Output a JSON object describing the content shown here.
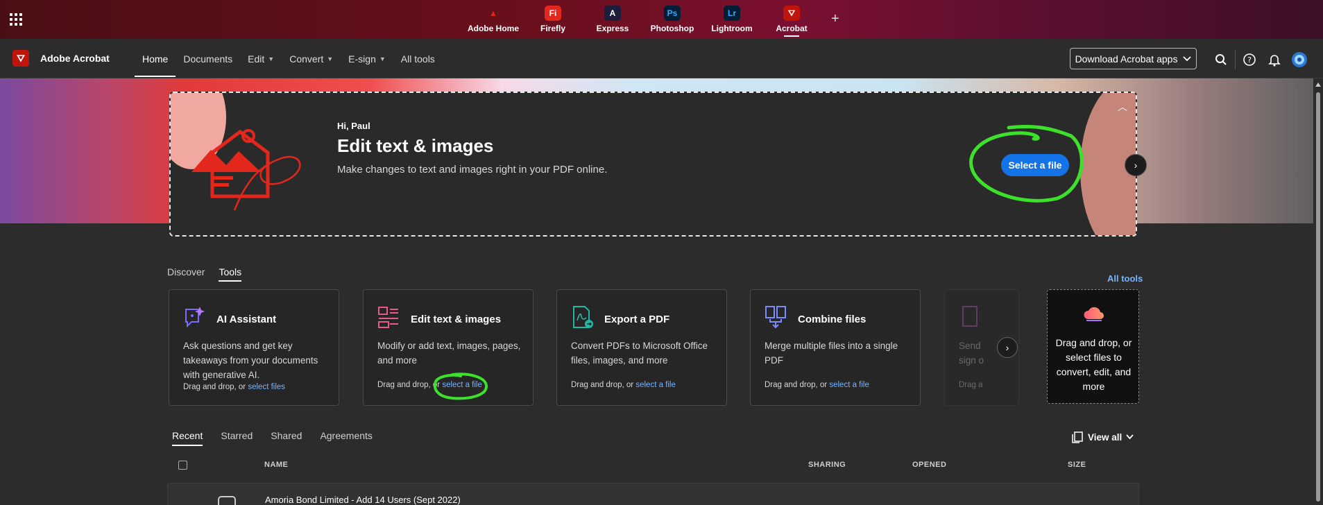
{
  "apps": [
    {
      "name": "Adobe Home",
      "icon": "adobe-home-icon",
      "glyph": "▲",
      "color": "transparent",
      "textColor": "#e3271d"
    },
    {
      "name": "Firefly",
      "icon": "firefly-icon",
      "glyph": "Fi",
      "color": "#e3271d",
      "textColor": "#fff"
    },
    {
      "name": "Express",
      "icon": "express-icon",
      "glyph": "A",
      "color": "#1b1d3a",
      "textColor": "#fff"
    },
    {
      "name": "Photoshop",
      "icon": "photoshop-icon",
      "glyph": "Ps",
      "color": "#001e36",
      "textColor": "#31a8ff"
    },
    {
      "name": "Lightroom",
      "icon": "lightroom-icon",
      "glyph": "Lr",
      "color": "#001e36",
      "textColor": "#31a8ff"
    },
    {
      "name": "Acrobat",
      "icon": "acrobat-icon",
      "glyph": "⛛",
      "color": "#c0150d",
      "textColor": "#fff"
    }
  ],
  "brand": {
    "title": "Adobe Acrobat"
  },
  "nav": {
    "items": [
      "Home",
      "Documents",
      "Edit",
      "Convert",
      "E-sign",
      "All tools"
    ],
    "download_label": "Download Acrobat apps"
  },
  "hero": {
    "greeting": "Hi, Paul",
    "headline": "Edit text & images",
    "subtitle": "Make changes to text and images right in your PDF online.",
    "button": "Select a file"
  },
  "tabs": [
    "Discover",
    "Tools"
  ],
  "all_tools_link": "All tools",
  "cards": [
    {
      "title": "AI Assistant",
      "desc": "Ask questions and get key takeaways from your documents with generative AI.",
      "drag_prefix": "Drag and drop, or",
      "link": "select files"
    },
    {
      "title": "Edit text & images",
      "desc": "Modify or add text, images, pages, and more",
      "drag_prefix": "Drag and drop, or",
      "link": "select a file"
    },
    {
      "title": "Export a PDF",
      "desc": "Convert PDFs to Microsoft Office files, images, and more",
      "drag_prefix": "Drag and drop, or",
      "link": "select a file"
    },
    {
      "title": "Combine files",
      "desc": "Merge multiple files into a single PDF",
      "drag_prefix": "Drag and drop, or",
      "link": "select a file"
    },
    {
      "title": "",
      "desc": "Send sign o",
      "drag_prefix": "Drag a",
      "link": ""
    }
  ],
  "dropzone": {
    "text": "Drag and drop, or select files to convert, edit, and more"
  },
  "recent": {
    "tabs": [
      "Recent",
      "Starred",
      "Shared",
      "Agreements"
    ],
    "view_all": "View all",
    "columns": {
      "name": "NAME",
      "sharing": "SHARING",
      "opened": "OPENED",
      "size": "SIZE"
    },
    "rows": [
      {
        "name": "Amoria Bond Limited - Add 14 Users (Sept 2022)"
      }
    ]
  }
}
